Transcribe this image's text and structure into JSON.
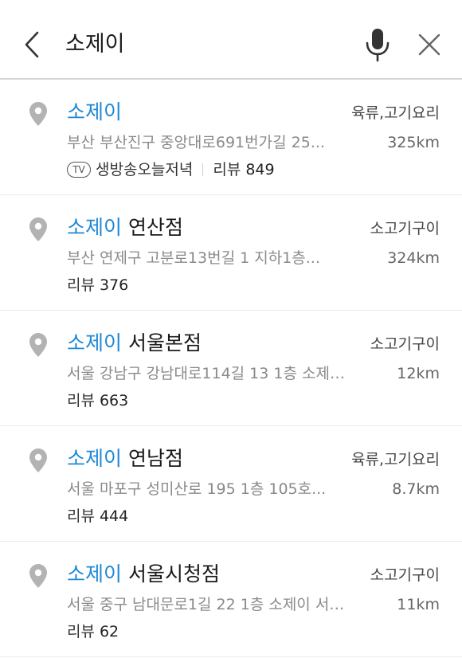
{
  "header": {
    "query": "소제이",
    "back_icon": "chevron-left-icon",
    "mic_icon": "microphone-icon",
    "close_icon": "close-icon"
  },
  "colors": {
    "highlight": "#1e88d6",
    "pin": "#b3b3b3"
  },
  "results": [
    {
      "name_highlight": "소제이",
      "name_rest": "",
      "category": "육류,고기요리",
      "address": "부산 부산진구 중앙대로691번가길 25...",
      "distance": "325km",
      "tv_badge": "TV",
      "tv_label": "생방송오늘저녁",
      "review_label": "리뷰",
      "review_count": "849"
    },
    {
      "name_highlight": "소제이",
      "name_rest": " 연산점",
      "category": "소고기구이",
      "address": "부산 연제구 고분로13번길 1 지하1층...",
      "distance": "324km",
      "review_label": "리뷰",
      "review_count": "376"
    },
    {
      "name_highlight": "소제이",
      "name_rest": " 서울본점",
      "category": "소고기구이",
      "address": "서울 강남구 강남대로114길 13 1층 소제…",
      "distance": "12km",
      "review_label": "리뷰",
      "review_count": "663"
    },
    {
      "name_highlight": "소제이",
      "name_rest": " 연남점",
      "category": "육류,고기요리",
      "address": "서울 마포구 성미산로 195 1층 105호...",
      "distance": "8.7km",
      "review_label": "리뷰",
      "review_count": "444"
    },
    {
      "name_highlight": "소제이",
      "name_rest": " 서울시청점",
      "category": "소고기구이",
      "address": "서울 중구 남대문로1길 22 1층 소제이 서…",
      "distance": "11km",
      "review_label": "리뷰",
      "review_count": "62"
    }
  ]
}
